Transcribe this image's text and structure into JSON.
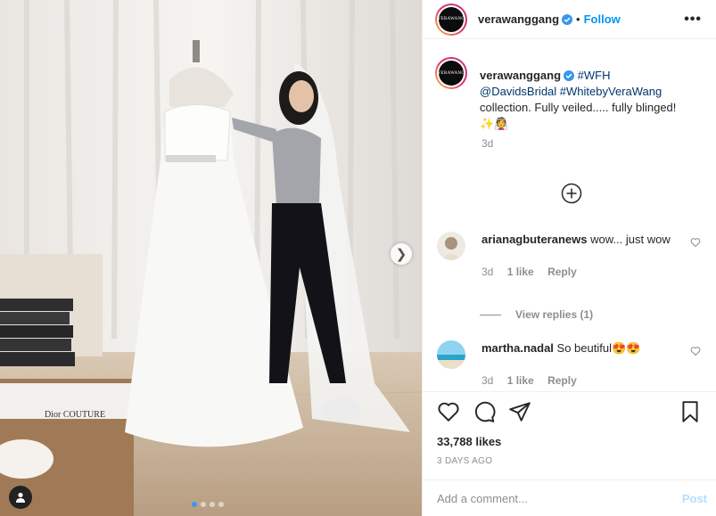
{
  "post": {
    "username": "verawanggang",
    "avatar_text": "VERAWANG",
    "separator": "•",
    "follow_label": "Follow",
    "more_icon": "more-options-icon",
    "caption_parts": [
      "#WFH",
      "@DavidsBridal",
      "#WhitebyVeraWang",
      "collection. Fully veiled..... fully blinged!"
    ],
    "caption_emoji": "✨👰",
    "caption_age": "3d",
    "load_more_icon": "plus-circle-icon"
  },
  "comments": [
    {
      "username": "arianagbuteranews",
      "text": "wow... just wow",
      "age": "3d",
      "likes": "1 like",
      "reply": "Reply",
      "view_replies": "View replies (1)"
    },
    {
      "username": "martha.nadal",
      "text": "So beutiful😍😍",
      "age": "3d",
      "likes": "1 like",
      "reply": "Reply"
    }
  ],
  "footer": {
    "likes": "33,788 likes",
    "posted_ago": "3 DAYS AGO",
    "comment_placeholder": "Add a comment...",
    "post_label": "Post"
  },
  "carousel": {
    "total_slides": 4,
    "active_slide": 1
  },
  "colors": {
    "link": "#0095f6",
    "tag": "#00376b",
    "muted": "#8e8e8e",
    "post_disabled": "#b2dffc"
  }
}
